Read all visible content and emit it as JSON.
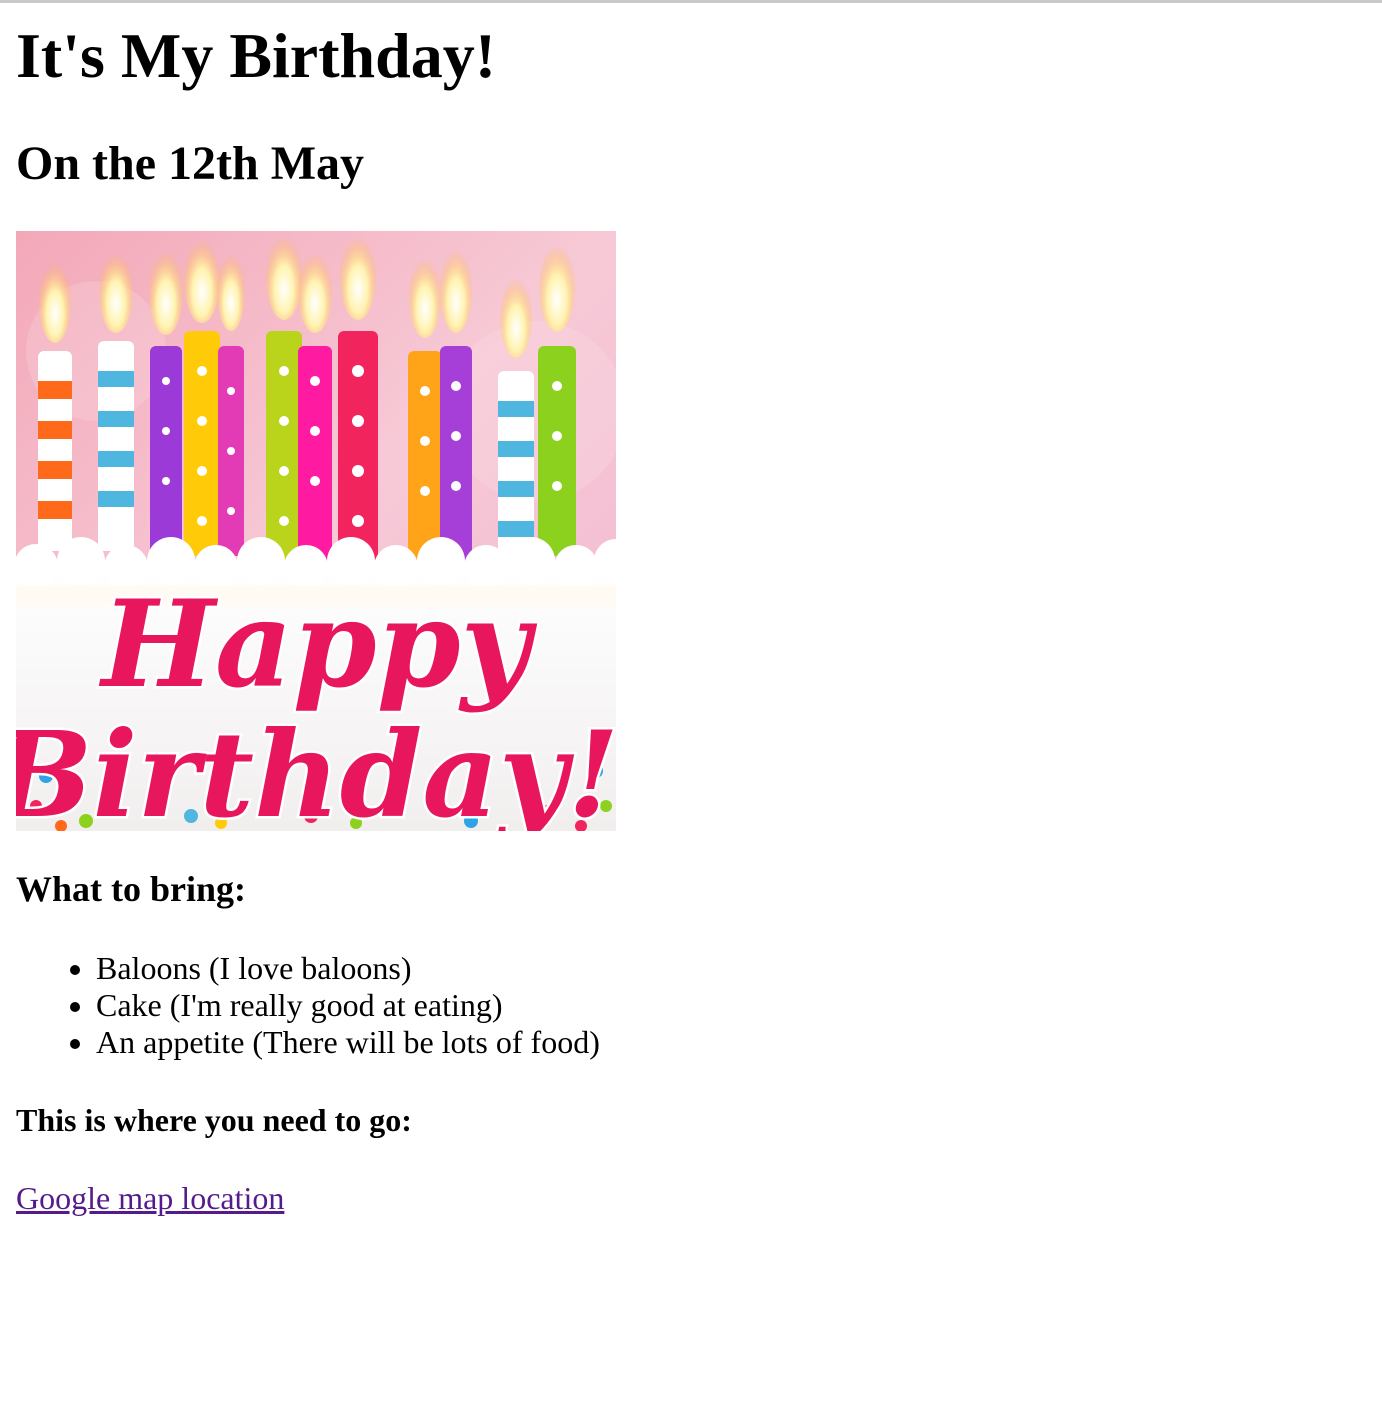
{
  "page": {
    "title": "It's My Birthday!",
    "subtitle": "On the 12th May"
  },
  "hero_image": {
    "text_line1": "Happy",
    "text_line2": "Birthday!"
  },
  "bring": {
    "heading": "What to bring:",
    "items": [
      "Baloons (I love baloons)",
      "Cake (I'm really good at eating)",
      "An appetite (There will be lots of food)"
    ]
  },
  "directions": {
    "heading": "This is where you need to go:",
    "link_label": "Google map location"
  },
  "colors": {
    "link_visited": "#551a8b",
    "script_pink": "#e8175d"
  }
}
